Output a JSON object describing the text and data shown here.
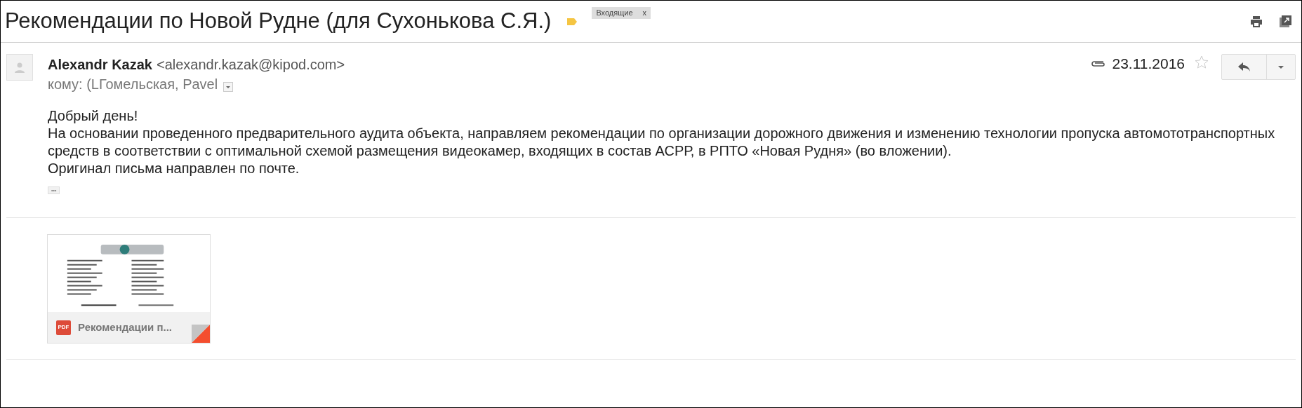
{
  "subject": "Рекомендации по Новой Рудне (для Сухонькова С.Я.)",
  "labels": [
    {
      "text": "Входящие",
      "remove": "x"
    }
  ],
  "message": {
    "sender_name": "Alexandr Kazak",
    "sender_email": "<alexandr.kazak@kipod.com>",
    "to": "кому: (LГомельская, Pavel",
    "date": "23.11.2016",
    "starred": false,
    "body": [
      "Добрый день!",
      "На основании проведенного предварительного аудита объекта, направляем рекомендации по организации дорожного движения и изменению технологии пропуска автомототранспортных средств в соответствии с оптимальной схемой размещения видеокамер, входящих в состав АСРР, в РПТО «Новая Рудня» (во вложении).",
      "Оригинал письма направлен по почте."
    ],
    "trimmed": "•••"
  },
  "attachments": [
    {
      "kind": "pdf",
      "badge": "PDF",
      "name": "Рекомендации п..."
    }
  ]
}
